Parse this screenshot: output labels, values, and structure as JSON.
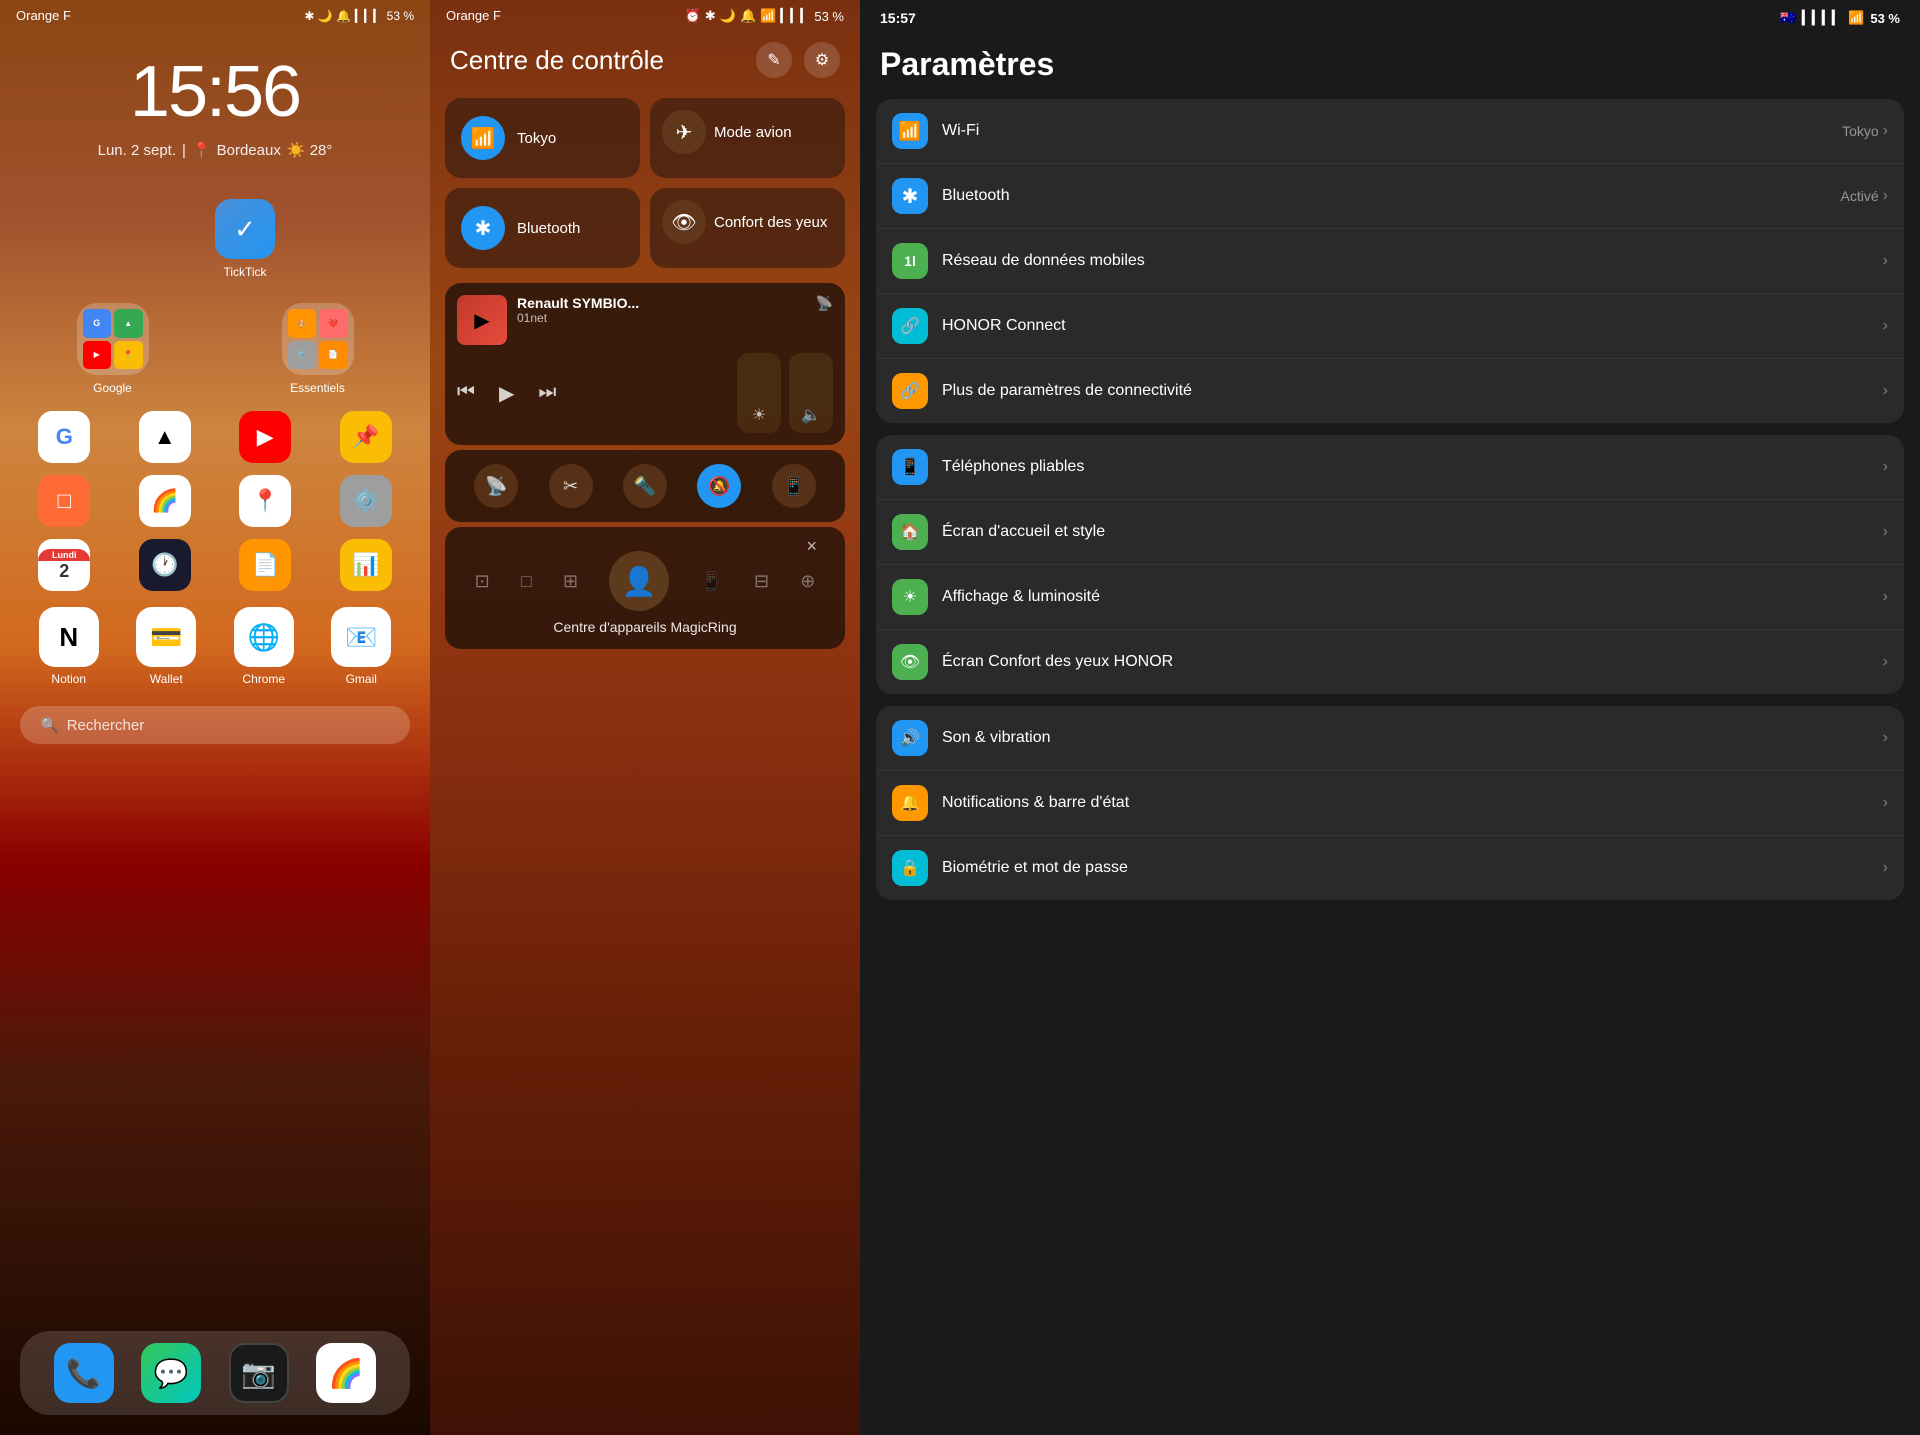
{
  "home": {
    "status": {
      "carrier": "Orange F",
      "time": "15:56",
      "icons": "✱ 🌙 🔔 📶 🔋",
      "battery": "53 %"
    },
    "clock": "15:56",
    "date": "Lun. 2 sept.",
    "location": "Bordeaux",
    "weather": "☀️ 28°",
    "ticktick": {
      "label": "TickTick",
      "icon": "✓"
    },
    "google_folder": {
      "label": "Google"
    },
    "essentiels_folder": {
      "label": "Essentiels"
    },
    "dock_apps": [
      {
        "label": "Phone",
        "icon": "📞"
      },
      {
        "label": "Messages",
        "icon": "💬"
      },
      {
        "label": "Camera",
        "icon": "📷"
      },
      {
        "label": "Photos",
        "icon": "🌈"
      }
    ],
    "row_apps": [
      {
        "label": "Notion",
        "icon": "N"
      },
      {
        "label": "Wallet",
        "icon": "💳"
      },
      {
        "label": "Chrome",
        "icon": "🌐"
      },
      {
        "label": "Gmail",
        "icon": "M"
      }
    ],
    "search_placeholder": "Rechercher"
  },
  "control_center": {
    "status": {
      "carrier": "Orange F",
      "time": "",
      "battery": "53 %"
    },
    "title": "Centre de contrôle",
    "tiles": [
      {
        "label": "Tokyo",
        "type": "wifi",
        "active": true
      },
      {
        "label": "Mode avion",
        "type": "airplane",
        "active": false
      },
      {
        "label": "Bluetooth",
        "type": "bluetooth",
        "active": true
      },
      {
        "label": "Confort des yeux",
        "type": "eye",
        "active": false
      }
    ],
    "media": {
      "title": "Renault SYMBIO...",
      "source": "01net",
      "playing": true
    },
    "quick_tiles": [
      {
        "label": "hotspot",
        "icon": "📡"
      },
      {
        "label": "scissors",
        "icon": "✂️"
      },
      {
        "label": "flashlight",
        "icon": "🔦"
      },
      {
        "label": "mute",
        "icon": "🔕",
        "active": true
      },
      {
        "label": "flip",
        "icon": "📱"
      }
    ],
    "magicring": {
      "title": "Centre d'appareils MagicRing",
      "close": "×"
    }
  },
  "settings": {
    "status": {
      "time": "15:57",
      "battery": "53 %"
    },
    "title": "Paramètres",
    "items": [
      {
        "section": 1,
        "entries": [
          {
            "id": "wifi",
            "label": "Wi-Fi",
            "value": "Tokyo",
            "icon_color": "#2196F3",
            "icon": "📶"
          },
          {
            "id": "bluetooth",
            "label": "Bluetooth",
            "value": "Activé",
            "icon_color": "#2196F3",
            "icon": "🔵"
          },
          {
            "id": "data",
            "label": "Réseau de données mobiles",
            "value": "",
            "icon_color": "#4CAF50",
            "icon": "1l"
          },
          {
            "id": "honor-connect",
            "label": "HONOR Connect",
            "value": "",
            "icon_color": "#00BCD4",
            "icon": "🔗"
          },
          {
            "id": "more-connectivity",
            "label": "Plus de paramètres de connectivité",
            "value": "",
            "icon_color": "#FF9800",
            "icon": "🔗"
          }
        ]
      },
      {
        "section": 2,
        "entries": [
          {
            "id": "foldable",
            "label": "Téléphones pliables",
            "value": "",
            "icon_color": "#2196F3",
            "icon": "📱"
          },
          {
            "id": "home-style",
            "label": "Écran d'accueil et style",
            "value": "",
            "icon_color": "#4CAF50",
            "icon": "🏠"
          },
          {
            "id": "display",
            "label": "Affichage & luminosité",
            "value": "",
            "icon_color": "#4CAF50",
            "icon": "☀️"
          },
          {
            "id": "eye-comfort",
            "label": "Écran Confort des yeux HONOR",
            "value": "",
            "icon_color": "#4CAF50",
            "icon": "👁️"
          }
        ]
      },
      {
        "section": 3,
        "entries": [
          {
            "id": "sound",
            "label": "Son & vibration",
            "value": "",
            "icon_color": "#2196F3",
            "icon": "🔊"
          },
          {
            "id": "notifications",
            "label": "Notifications & barre d'état",
            "value": "",
            "icon_color": "#FF9800",
            "icon": "🔔"
          },
          {
            "id": "biometric",
            "label": "Biométrie et mot de passe",
            "value": "",
            "icon_color": "#00BCD4",
            "icon": "🔒"
          }
        ]
      }
    ]
  }
}
